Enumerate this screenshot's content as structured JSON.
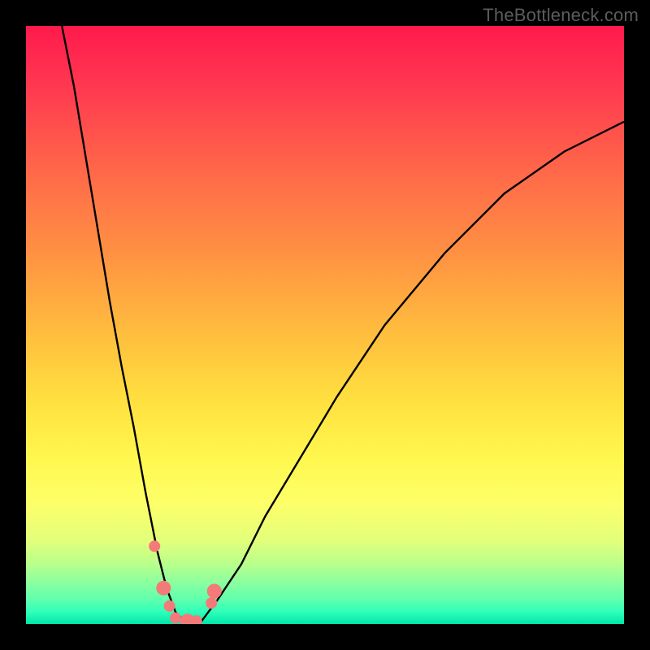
{
  "watermark": "TheBottleneck.com",
  "colors": {
    "frame": "#000000",
    "curve_stroke": "#000000",
    "dot_fill": "#f47a7a",
    "dot_stroke": "#d85a5a"
  },
  "chart_data": {
    "type": "line",
    "title": "",
    "xlabel": "",
    "ylabel": "",
    "xlim": [
      0,
      100
    ],
    "ylim": [
      0,
      100
    ],
    "note": "No axes, ticks, or numeric labels are shown. Values below are estimated from pixel positions (y = 0 at bottom green band, y = 100 at top red band).",
    "series": [
      {
        "name": "bottleneck_curve",
        "x": [
          6,
          8,
          10,
          12,
          14,
          16,
          18,
          20,
          22,
          23.5,
          25,
          27,
          29,
          32,
          36,
          40,
          46,
          52,
          60,
          70,
          80,
          90,
          100
        ],
        "y": [
          100,
          90,
          78,
          66,
          54,
          43,
          33,
          22,
          12,
          6,
          2,
          0,
          0,
          4,
          10,
          18,
          28,
          38,
          50,
          62,
          72,
          79,
          84
        ]
      }
    ],
    "dots": {
      "name": "highlighted_points",
      "x": [
        21.5,
        23.0,
        24.0,
        25.0,
        27.0,
        28.5,
        31.0,
        31.5
      ],
      "y": [
        13.0,
        6.0,
        3.0,
        1.0,
        0.5,
        0.5,
        3.5,
        5.5
      ]
    }
  }
}
